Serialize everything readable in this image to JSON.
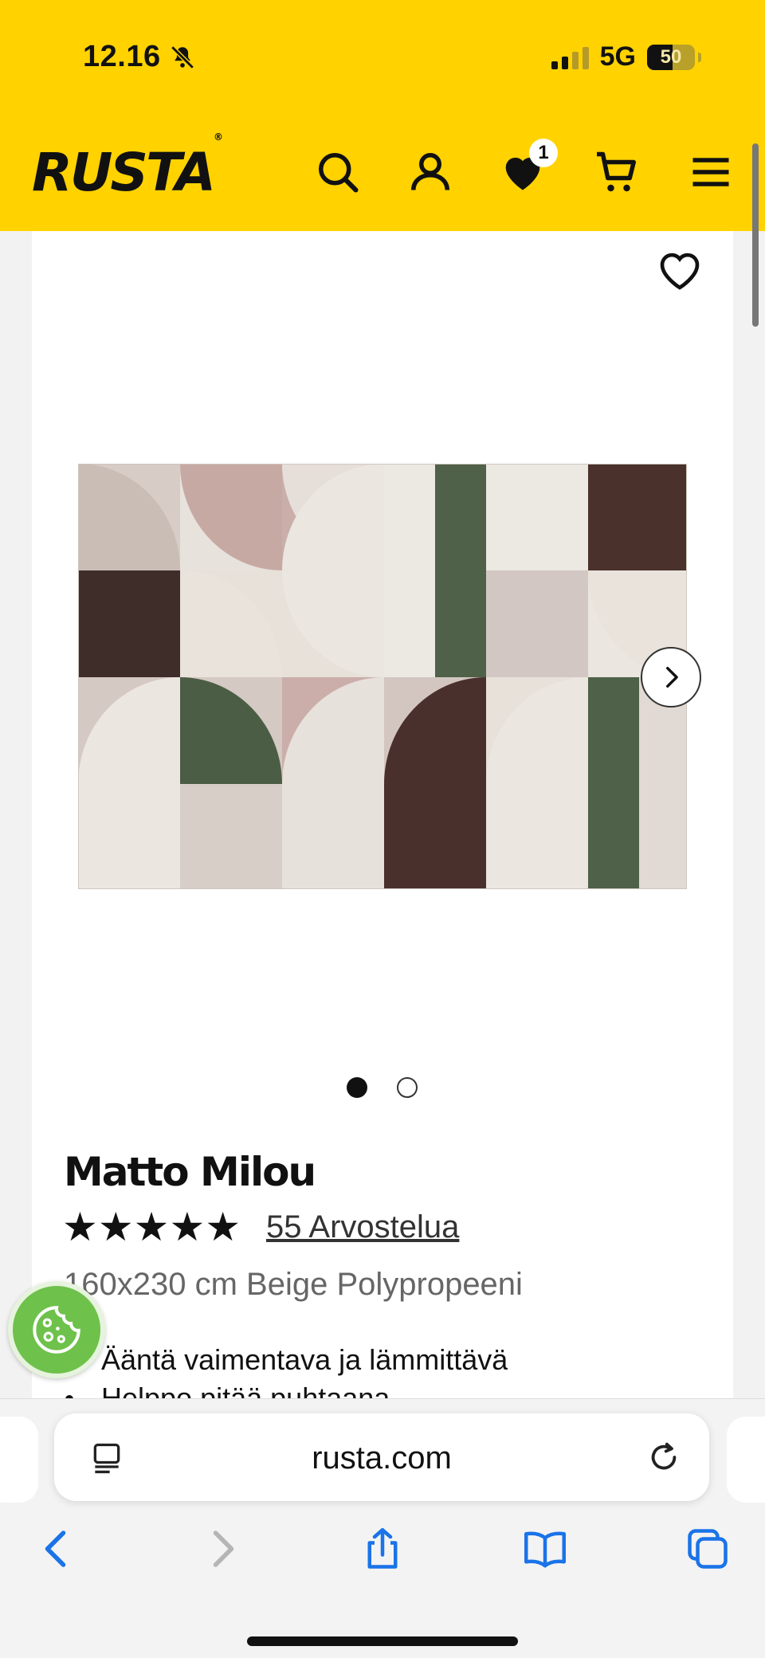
{
  "status": {
    "time": "12.16",
    "network": "5G",
    "battery": "50"
  },
  "header": {
    "logo": "RUSTA",
    "wishlist_count": "1"
  },
  "carousel": {
    "active_index": 1,
    "total": 2
  },
  "product": {
    "title": "Matto Milou",
    "rating": 5,
    "stars": "★★★★★",
    "reviews": "55 Arvostelua",
    "subtitle": "160x230 cm Beige Polypropeeni",
    "bullets": [
      "Ääntä vaimentava ja lämmittävä",
      "Helppo pitää puhtaana"
    ]
  },
  "browser": {
    "url": "rusta.com"
  },
  "icons": [
    "bell-slash-icon",
    "search-icon",
    "account-icon",
    "heart-icon",
    "cart-icon",
    "menu-icon",
    "chevron-right-icon",
    "cookie-icon",
    "reader-icon",
    "reload-icon",
    "back-icon",
    "forward-icon",
    "share-icon",
    "bookmarks-icon",
    "tabs-icon"
  ],
  "colors": {
    "brand_yellow": "#ffd200",
    "cookie_green": "#6ec14b",
    "safari_blue": "#1a73e8"
  }
}
